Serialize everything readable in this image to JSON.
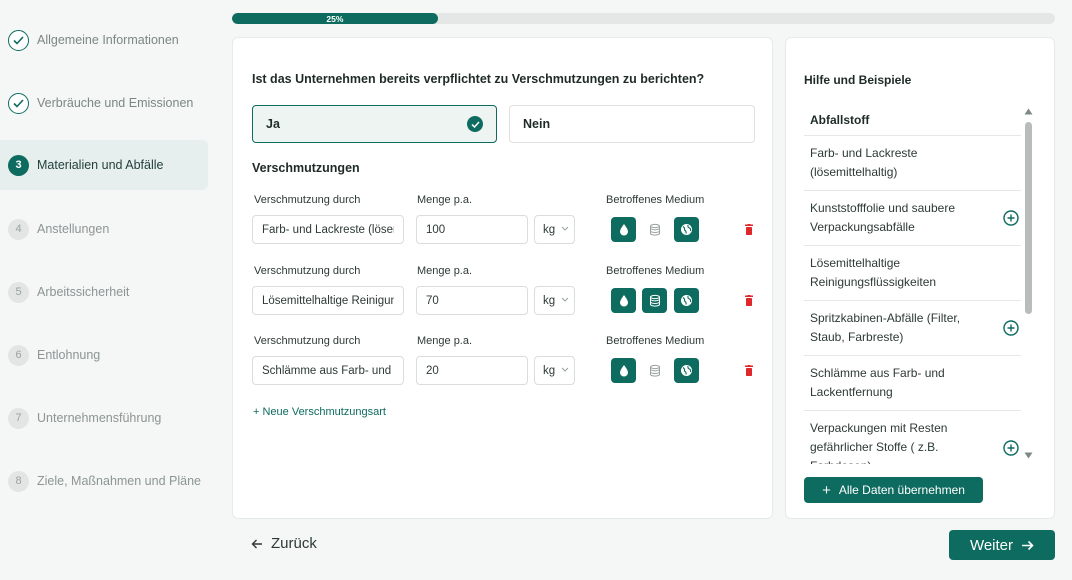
{
  "sidebar": {
    "steps": [
      {
        "number": "1",
        "label": "Allgemeine Informationen",
        "state": "done"
      },
      {
        "number": "2",
        "label": "Verbräuche und Emissionen",
        "state": "done"
      },
      {
        "number": "3",
        "label": "Materialien und Abfälle",
        "state": "current"
      },
      {
        "number": "4",
        "label": "Anstellungen",
        "state": "todo"
      },
      {
        "number": "5",
        "label": "Arbeitssicherheit",
        "state": "todo"
      },
      {
        "number": "6",
        "label": "Entlohnung",
        "state": "todo"
      },
      {
        "number": "7",
        "label": "Unternehmensführung",
        "state": "todo"
      },
      {
        "number": "8",
        "label": "Ziele, Maßnahmen und Pläne",
        "state": "todo"
      }
    ]
  },
  "progress": {
    "percent": 25,
    "label": "25%"
  },
  "form": {
    "question": "Ist das Unternehmen bereits verpflichtet zu Verschmutzungen zu berichten?",
    "options": {
      "yes": "Ja",
      "no": "Nein",
      "selected": "yes"
    },
    "section_title": "Verschmutzungen",
    "labels": {
      "source": "Verschmutzung durch",
      "amount": "Menge p.a.",
      "medium": "Betroffenes Medium"
    },
    "rows": [
      {
        "source": "Farb- und Lackreste (lösemittelhaltig)",
        "amount": "100",
        "unit": "kg",
        "water": true,
        "soil": false,
        "air": true
      },
      {
        "source": "Lösemittelhaltige Reinigungsflüssigkeiten",
        "amount": "70",
        "unit": "kg",
        "water": true,
        "soil": true,
        "air": true
      },
      {
        "source": "Schlämme aus Farb- und Lackentfernung",
        "amount": "20",
        "unit": "kg",
        "water": true,
        "soil": false,
        "air": true
      }
    ],
    "add_label": "+ Neue Verschmutzungsart"
  },
  "help": {
    "title": "Hilfe und Beispiele",
    "list_header": "Abfallstoff",
    "items": [
      {
        "text": "Farb- und Lackreste (lösemittelhaltig)",
        "addable": false
      },
      {
        "text": "Kunststofffolie und saubere Verpackungsabfälle",
        "addable": true
      },
      {
        "text": "Lösemittelhaltige Reinigungsflüssigkeiten",
        "addable": false
      },
      {
        "text": "Spritzkabinen-Abfälle (Filter, Staub, Farbreste)",
        "addable": true
      },
      {
        "text": "Schlämme aus Farb- und Lackentfernung",
        "addable": false
      },
      {
        "text": "Verpackungen mit Resten gefährlicher Stoffe ( z.B. Farbdosen)",
        "addable": true
      }
    ],
    "apply_all": "Alle Daten übernehmen"
  },
  "nav": {
    "back": "Zurück",
    "next": "Weiter"
  },
  "colors": {
    "accent": "#0d6b5f",
    "delete": "#e0272b"
  }
}
